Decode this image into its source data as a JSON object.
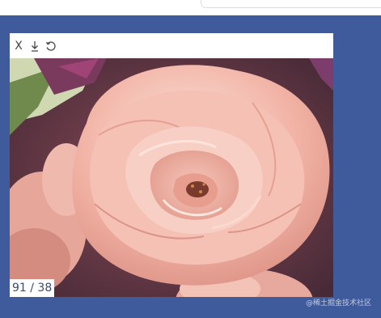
{
  "toolbar": {
    "close_label": "X",
    "download_icon": "download-icon",
    "rotate_icon": "rotate-icon"
  },
  "image": {
    "subject": "rose-icon",
    "counter": "91 / 38"
  },
  "watermark": "@稀土掘金技术社区",
  "colors": {
    "page_background": "#3f5b9c",
    "viewer_background": "#ffffff",
    "petal": "#f2b4a6"
  }
}
